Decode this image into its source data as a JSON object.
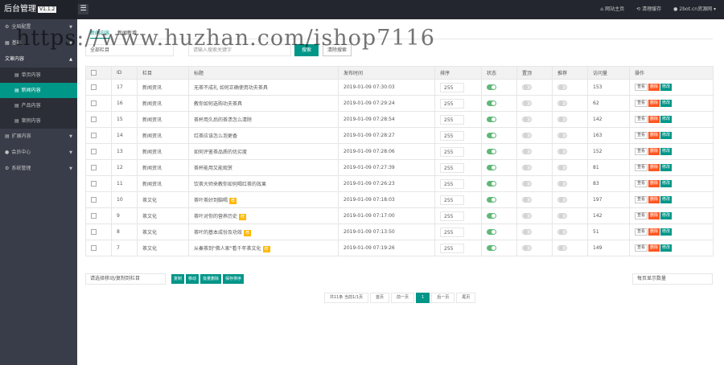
{
  "header": {
    "brand": "后台管理",
    "version": "V1.1.2",
    "menu_toggle_icon": "☰",
    "links": [
      {
        "icon": "⌂",
        "label": "网站主页"
      },
      {
        "icon": "⟲",
        "label": "清理缓存"
      },
      {
        "icon": "●",
        "label": "2bot.cn资源网 ▾"
      }
    ]
  },
  "sidebar": {
    "groups": [
      {
        "label": "全局配置",
        "caret": "▼"
      },
      {
        "label": "基础",
        "caret": "▼"
      },
      {
        "label": "文章内容",
        "caret": "▲"
      },
      {
        "label": "扩展内容",
        "caret": "▼"
      },
      {
        "label": "会员中心",
        "caret": "▼"
      },
      {
        "label": "系统管理",
        "caret": "▼"
      }
    ],
    "sub_items": [
      {
        "label": "单页内容"
      },
      {
        "label": "新闻内容"
      },
      {
        "label": "产品内容"
      },
      {
        "label": "案例内容"
      }
    ]
  },
  "tabs": [
    {
      "label": "新闻内容"
    },
    {
      "label": "新闻新增"
    }
  ],
  "filters": {
    "category_select": "全部栏目",
    "keyword_placeholder": "请输入搜索关键字",
    "search_btn": "搜索",
    "clear_btn": "清除搜索"
  },
  "table": {
    "headers": [
      "",
      "ID",
      "栏目",
      "标题",
      "发布时间",
      "排序",
      "状态",
      "置顶",
      "推荐",
      "访问量",
      "操作"
    ],
    "ops": {
      "view": "查看",
      "delete": "删除",
      "edit": "修改"
    },
    "rows": [
      {
        "id": "17",
        "category": "新闻资讯",
        "title": "无茶不成礼 如何正确使用功夫茶具",
        "time": "2019-01-09 07:30:03",
        "sort": "255",
        "status": "on",
        "top": "off",
        "rec": "off",
        "views": "153",
        "badge": ""
      },
      {
        "id": "16",
        "category": "新闻资讯",
        "title": "教你如何选购功夫茶具",
        "time": "2019-01-09 07:29:24",
        "sort": "255",
        "status": "on",
        "top": "off",
        "rec": "off",
        "views": "62",
        "badge": ""
      },
      {
        "id": "15",
        "category": "新闻资讯",
        "title": "茶杯用久后的茶渍怎么清除",
        "time": "2019-01-09 07:28:54",
        "sort": "255",
        "status": "on",
        "top": "off",
        "rec": "off",
        "views": "142",
        "badge": ""
      },
      {
        "id": "14",
        "category": "新闻资讯",
        "title": "红茶应该怎么泡更香",
        "time": "2019-01-09 07:28:27",
        "sort": "255",
        "status": "on",
        "top": "off",
        "rec": "off",
        "views": "163",
        "badge": ""
      },
      {
        "id": "13",
        "category": "新闻资讯",
        "title": "如何评鉴茶品质的优劣度",
        "time": "2019-01-09 07:28:06",
        "sort": "255",
        "status": "on",
        "top": "off",
        "rec": "off",
        "views": "152",
        "badge": ""
      },
      {
        "id": "12",
        "category": "新闻资讯",
        "title": "茶杯能用又能观赏",
        "time": "2019-01-09 07:27:39",
        "sort": "255",
        "status": "on",
        "top": "off",
        "rec": "off",
        "views": "81",
        "badge": ""
      },
      {
        "id": "11",
        "category": "新闻资讯",
        "title": "饮茶大师来教你如何喝红茶的效果",
        "time": "2019-01-09 07:26:23",
        "sort": "255",
        "status": "on",
        "top": "off",
        "rec": "off",
        "views": "83",
        "badge": ""
      },
      {
        "id": "10",
        "category": "茶文化",
        "title": "茶叶茶好到脑喝",
        "time": "2019-01-09 07:18:03",
        "sort": "255",
        "status": "on",
        "top": "off",
        "rec": "off",
        "views": "197",
        "badge": "荐"
      },
      {
        "id": "9",
        "category": "茶文化",
        "title": "茶叶对你的营养历史",
        "time": "2019-01-09 07:17:00",
        "sort": "255",
        "status": "on",
        "top": "off",
        "rec": "off",
        "views": "142",
        "badge": "荐"
      },
      {
        "id": "8",
        "category": "茶文化",
        "title": "茶叶的基本成份及功效",
        "time": "2019-01-09 07:13:50",
        "sort": "255",
        "status": "on",
        "top": "off",
        "rec": "off",
        "views": "51",
        "badge": "荐"
      },
      {
        "id": "7",
        "category": "茶文化",
        "title": "从秦茶到\"佛人家\"看千年茶文化",
        "time": "2019-01-09 07:19:26",
        "sort": "255",
        "status": "on",
        "top": "off",
        "rec": "off",
        "views": "149",
        "badge": "荐"
      }
    ]
  },
  "bulk": {
    "move_select": "请选择移动/复制到栏目",
    "buttons": [
      "复制",
      "移动",
      "批量删除",
      "保存排序"
    ],
    "per_page": "每页显示数量"
  },
  "pager": {
    "info": "共11条 当前1/1页",
    "first": "首页",
    "prev": "前一页",
    "current": "1",
    "next": "后一页",
    "last": "尾页"
  },
  "watermark": "https://www.huzhan.com/ishop7116",
  "colors": {
    "accent": "#009688",
    "danger": "#FF5722",
    "warn": "#FFB800",
    "topbar": "#23262E",
    "sidebar": "#393D49"
  }
}
